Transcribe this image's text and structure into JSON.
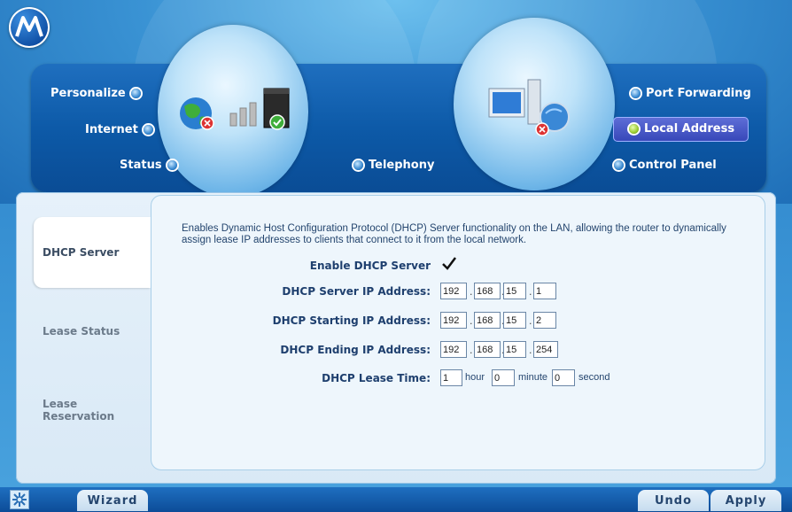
{
  "nav": {
    "personalize": "Personalize",
    "internet": "Internet",
    "status": "Status",
    "telephony": "Telephony",
    "port_forwarding": "Port Forwarding",
    "local_address": "Local Address",
    "control_panel": "Control Panel",
    "active": "Local Address"
  },
  "sidebar": {
    "items": [
      {
        "label": "DHCP Server",
        "active": true
      },
      {
        "label": "Lease Status",
        "active": false
      },
      {
        "label": "Lease Reservation",
        "active": false
      }
    ]
  },
  "content": {
    "description": "Enables Dynamic Host Configuration Protocol (DHCP) Server functionality on the LAN, allowing the router to dynamically assign lease IP addresses to clients that connect to it from the local network.",
    "enable_label": "Enable DHCP Server",
    "enable_checked": true,
    "server_ip_label": "DHCP Server IP Address:",
    "server_ip": [
      "192",
      "168",
      "15",
      "1"
    ],
    "start_ip_label": "DHCP Starting IP Address:",
    "start_ip": [
      "192",
      "168",
      "15",
      "2"
    ],
    "end_ip_label": "DHCP Ending IP Address:",
    "end_ip": [
      "192",
      "168",
      "15",
      "254"
    ],
    "lease_label": "DHCP Lease Time:",
    "lease_hour": "1",
    "lease_minute": "0",
    "lease_second": "0",
    "hour_unit": "hour",
    "minute_unit": "minute",
    "second_unit": "second"
  },
  "footer": {
    "wizard": "Wizard",
    "undo": "Undo",
    "apply": "Apply"
  },
  "colors": {
    "accent": "#0d5aa8",
    "active_pill": "#3646b8",
    "active_dot": "#9acb2e"
  }
}
